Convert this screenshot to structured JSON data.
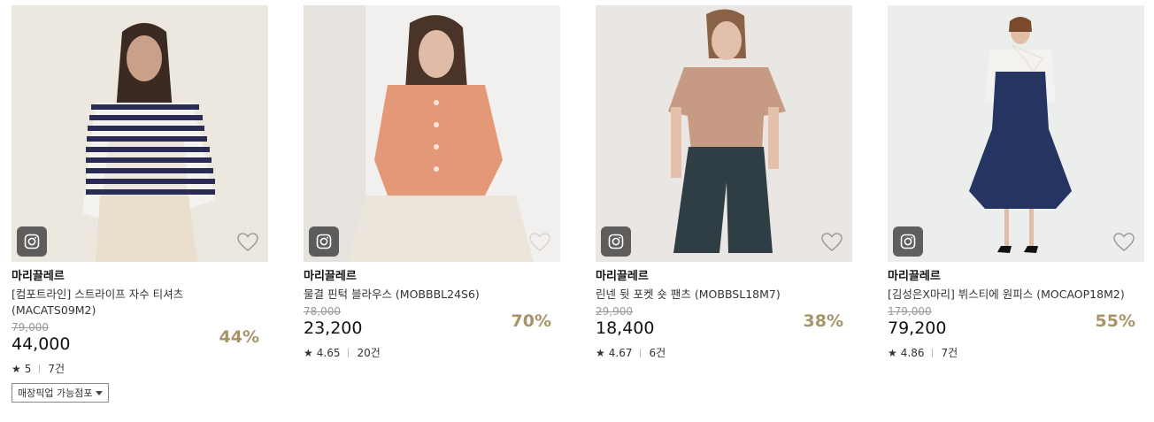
{
  "products": [
    {
      "brand": "마리끌레르",
      "name": "[컴포트라인] 스트라이프 자수 티셔츠 (MACATS09M2)",
      "original_price": "79,000",
      "price": "44,000",
      "discount": "44%",
      "rating": "5",
      "reviews": "7건",
      "pickup_label": "매장픽업 가능점포"
    },
    {
      "brand": "마리끌레르",
      "name": "물결 핀턱 블라우스 (MOBBBL24S6)",
      "original_price": "78,000",
      "price": "23,200",
      "discount": "70%",
      "rating": "4.65",
      "reviews": "20건"
    },
    {
      "brand": "마리끌레르",
      "name": "린넨 뒷 포켓 숏 팬츠 (MOBBSL18M7)",
      "original_price": "29,900",
      "price": "18,400",
      "discount": "38%",
      "rating": "4.67",
      "reviews": "6건"
    },
    {
      "brand": "마리끌레르",
      "name": "[김성은X마리] 뷔스티에 원피스 (MOCAOP18M2)",
      "original_price": "179,000",
      "price": "79,200",
      "discount": "55%",
      "rating": "4.86",
      "reviews": "7건"
    }
  ],
  "colors": {
    "discount": "#a89468",
    "bg1": "#ece7df",
    "bg2": "#f2f0ee",
    "bg3": "#e9e6e3",
    "bg4": "#eceeed"
  },
  "icons": [
    "instagram-icon",
    "heart-icon",
    "star-icon",
    "caret-down-icon"
  ]
}
